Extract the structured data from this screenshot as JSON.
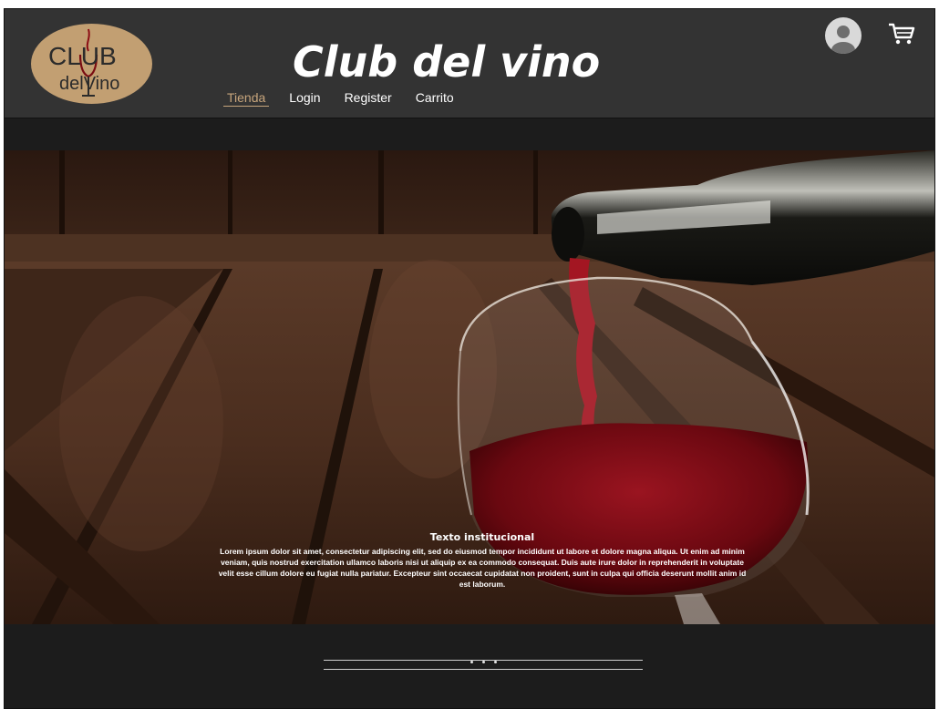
{
  "logo": {
    "line1": "CLUB",
    "line2": "delVino"
  },
  "header": {
    "title": "Club del vino"
  },
  "nav": {
    "items": [
      {
        "label": "Tienda",
        "active": true
      },
      {
        "label": "Login",
        "active": false
      },
      {
        "label": "Register",
        "active": false
      },
      {
        "label": "Carrito",
        "active": false
      }
    ]
  },
  "icons": {
    "avatar": "user-avatar-icon",
    "cart": "shopping-cart-icon"
  },
  "hero": {
    "title": "Texto institucional",
    "body": "Lorem ipsum dolor sit amet, consectetur adipiscing elit, sed do eiusmod tempor incididunt ut labore et dolore magna aliqua. Ut enim ad minim veniam, quis nostrud exercitation ullamco laboris nisi ut aliquip ex ea commodo consequat. Duis aute irure dolor in reprehenderit in voluptate velit esse cillum dolore eu fugiat nulla pariatur. Excepteur sint occaecat cupidatat non proident, sunt in culpa qui officia deserunt mollit anim id est laborum."
  },
  "carousel": {
    "dots": 3
  },
  "colors": {
    "header_bg": "#333333",
    "page_bg": "#1c1c1c",
    "logo_bg": "#c29f72",
    "accent": "#c7a57c",
    "wine": "#7a0c12"
  }
}
